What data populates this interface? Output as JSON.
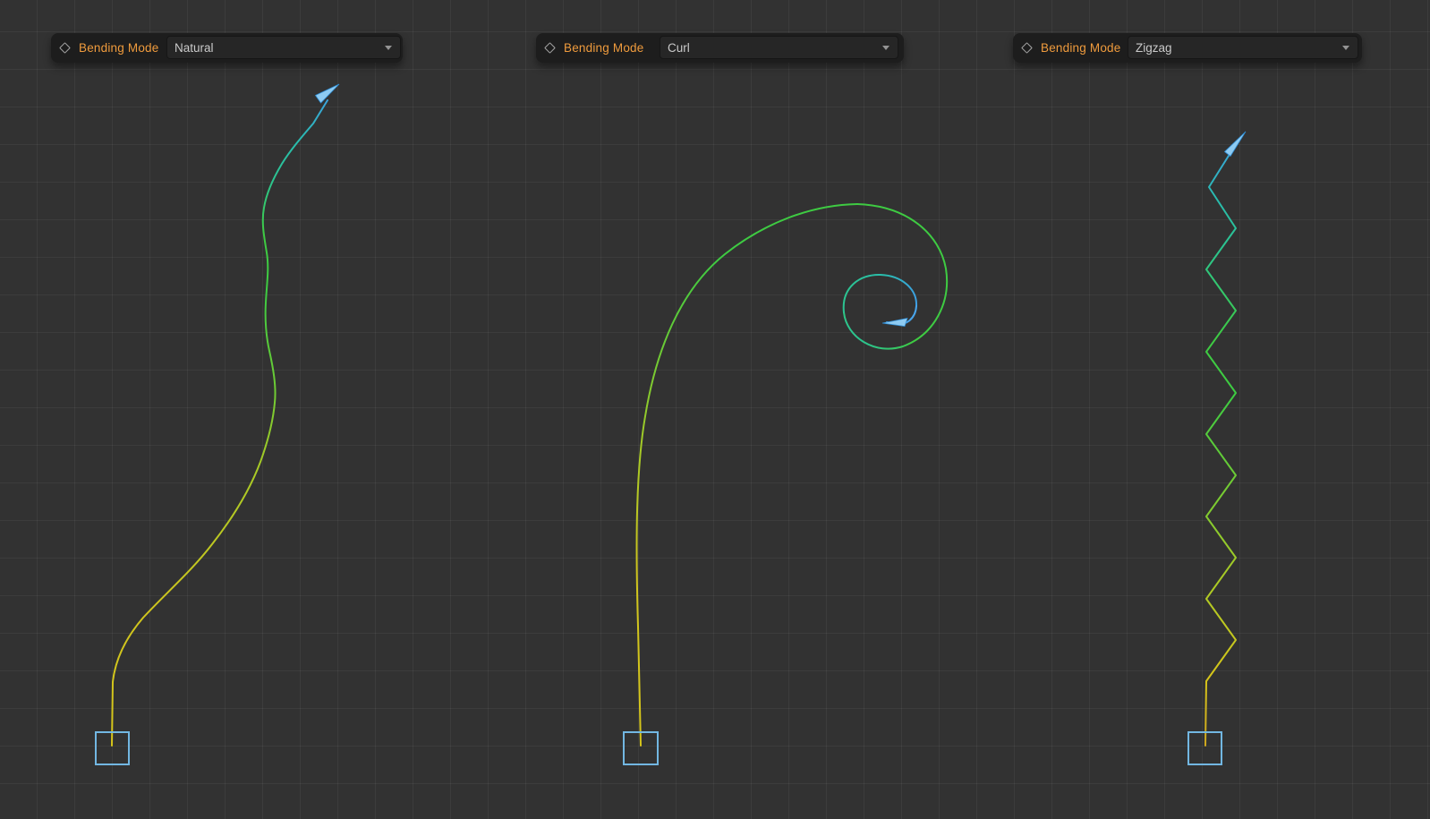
{
  "viewport": {
    "description": "deformer bending-mode comparison viewport with grid",
    "panels": [
      {
        "label": "Bending Mode",
        "value": "Natural",
        "icon": "diamond"
      },
      {
        "label": "Bending Mode",
        "value": "Curl",
        "icon": "diamond"
      },
      {
        "label": "Bending Mode",
        "value": "Zigzag",
        "icon": "diamond"
      }
    ],
    "curves": [
      {
        "name": "natural-curve",
        "mode": "Natural",
        "start_anchor": "blue square bottom-left",
        "end": "blue arrow top"
      },
      {
        "name": "curl-curve",
        "mode": "Curl",
        "start_anchor": "blue square bottom-center",
        "end": "blue arrow at spiral center"
      },
      {
        "name": "zigzag-curve",
        "mode": "Zigzag",
        "start_anchor": "blue square bottom-right",
        "end": "blue arrow top"
      }
    ]
  },
  "colors": {
    "canvas_bg": "#323232",
    "grid_line": "rgba(255,255,255,0.05)",
    "panel_bg": "#1d1d1d",
    "field_bg": "#262626",
    "field_border": "#161616",
    "label_orange": "#ef9b3d",
    "value_text": "#cacaca",
    "icon_gray": "#a5a5a5",
    "curve_gold": "#d0a81e",
    "curve_yellow": "#d6c51a",
    "curve_yellow2": "#cfc51e",
    "curve_yellowgreen": "#a6ca26",
    "curve_green2": "#6fcb34",
    "curve_green": "#3ecb42",
    "curve_tealgreen": "#2cc48e",
    "curve_teal": "#29bcae",
    "curve_blue": "#3f9de8",
    "curve_lightblue": "#49a5ec",
    "arrow_fill": "#8ecbf2",
    "arrow_edge": "#3090d8",
    "square_stroke": "#72b7e2"
  }
}
